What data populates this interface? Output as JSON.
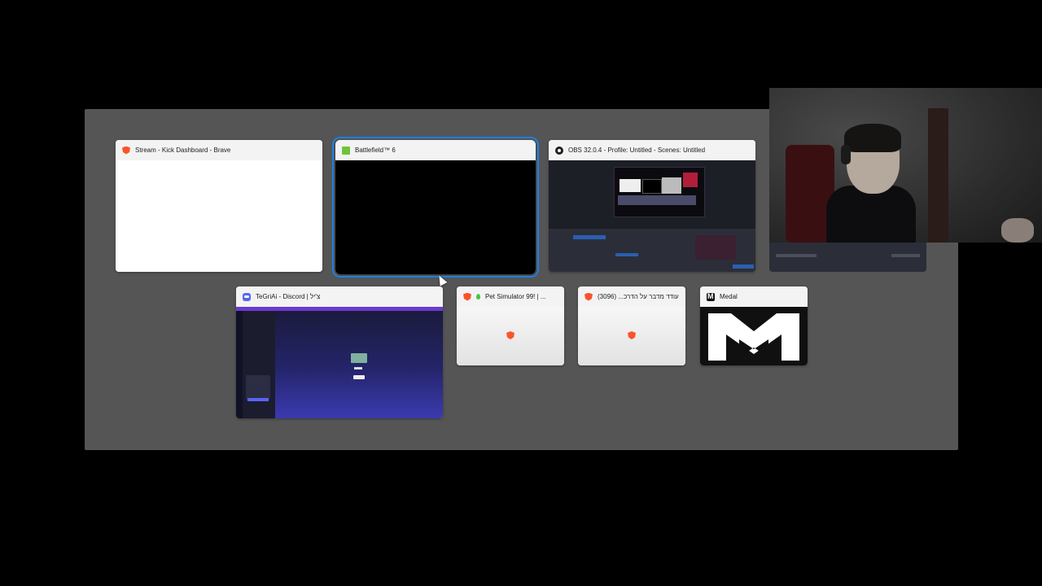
{
  "switcher": {
    "windows": [
      {
        "title": "Stream - Kick Dashboard - Brave",
        "icon": "brave-icon"
      },
      {
        "title": "Battlefield™ 6",
        "icon": "battlefield-icon",
        "selected": true
      },
      {
        "title": "OBS 32.0.4 - Profile: Untitled - Scenes: Untitled",
        "icon": "obs-icon"
      },
      {
        "title": "TeGriAi - Discord | צ'יל",
        "icon": "discord-icon"
      },
      {
        "title": "Pet Simulator 99! | ...",
        "icon": "brave-icon"
      },
      {
        "title": "עודד מדבר על הדרכ... (3096)",
        "icon": "brave-icon"
      },
      {
        "title": "Medal",
        "icon": "medal-icon"
      }
    ]
  },
  "webcam": {
    "label": "webcam-overlay"
  },
  "colors": {
    "switcher_bg": "#555555",
    "selection": "#1f7fe0",
    "discord_purple": "#5865f2",
    "brave_orange": "#fb542b"
  }
}
